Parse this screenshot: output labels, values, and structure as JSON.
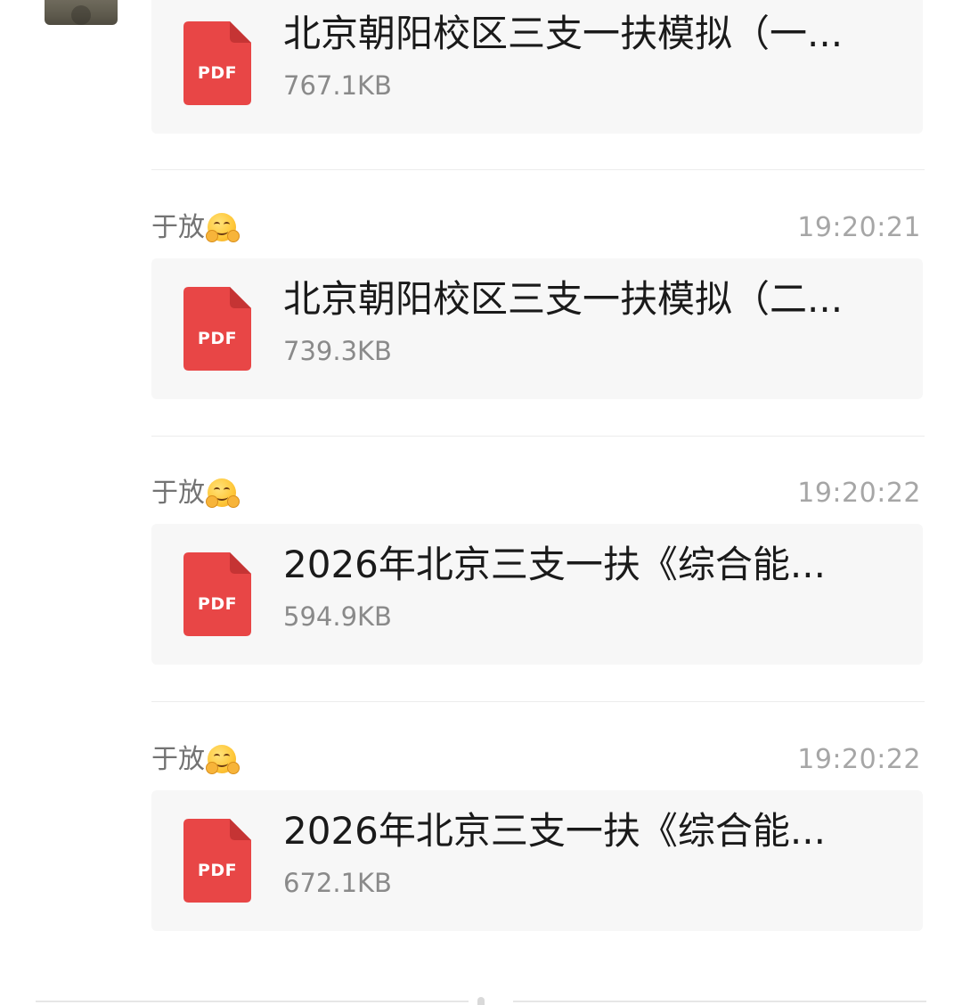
{
  "pdf_icon": {
    "label": "PDF",
    "color": "#e84646",
    "fold_color": "#c53434"
  },
  "messages": [
    {
      "file": {
        "name": "北京朝阳校区三支一扶模拟（一...",
        "size": "767.1KB",
        "type": "pdf-icon"
      }
    },
    {
      "sender": "于放",
      "sender_emoji": "hugging-face-icon",
      "time": "19:20:21",
      "file": {
        "name": "北京朝阳校区三支一扶模拟（二...",
        "size": "739.3KB",
        "type": "pdf-icon"
      }
    },
    {
      "sender": "于放",
      "sender_emoji": "hugging-face-icon",
      "time": "19:20:22",
      "file": {
        "name": "2026年北京三支一扶《综合能...",
        "size": "594.9KB",
        "type": "pdf-icon"
      }
    },
    {
      "sender": "于放",
      "sender_emoji": "hugging-face-icon",
      "time": "19:20:22",
      "file": {
        "name": "2026年北京三支一扶《综合能...",
        "size": "672.1KB",
        "type": "pdf-icon"
      }
    }
  ]
}
